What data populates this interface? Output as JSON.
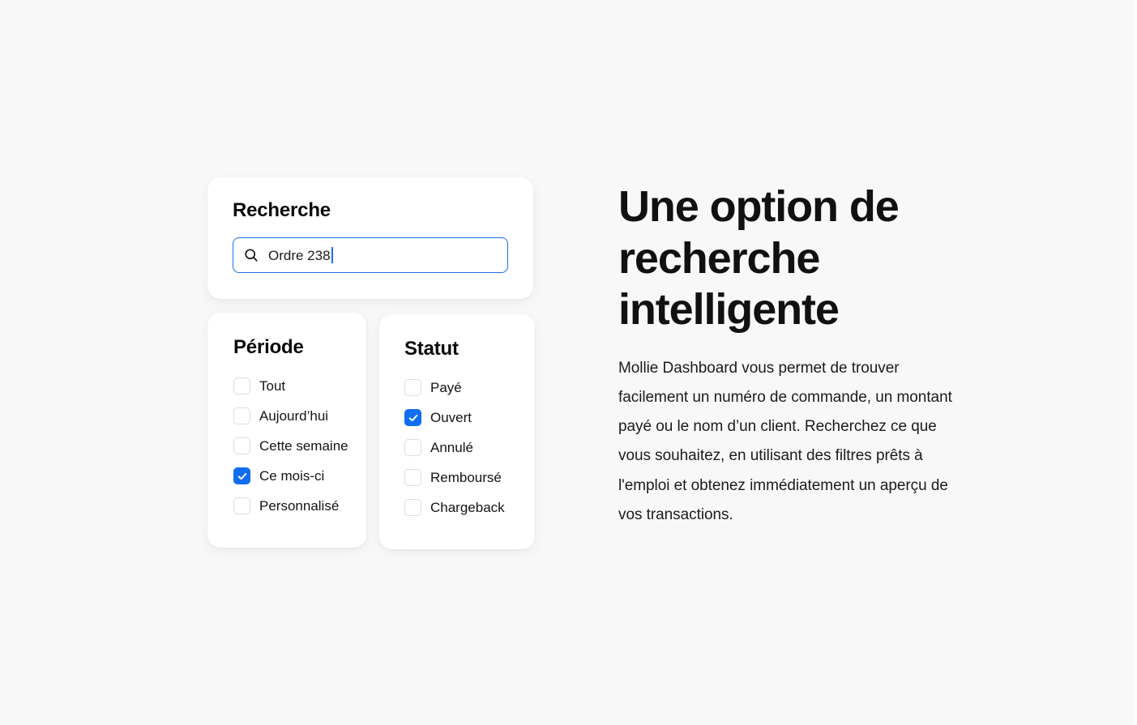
{
  "theme": {
    "background": "#f8f8f8",
    "card_background": "#ffffff",
    "accent_blue": "#0f6ef2",
    "focus_border": "#1a6ff0",
    "text_primary": "#111111",
    "checkbox_border": "#dedede"
  },
  "search_card": {
    "title": "Recherche",
    "icon": "search-icon",
    "value": "Ordre 238",
    "placeholder": "Recherche"
  },
  "period_card": {
    "title": "Période",
    "options": [
      {
        "label": "Tout",
        "checked": false
      },
      {
        "label": "Aujourd’hui",
        "checked": false
      },
      {
        "label": "Cette semaine",
        "checked": false
      },
      {
        "label": "Ce mois-ci",
        "checked": true
      },
      {
        "label": "Personnalisé",
        "checked": false
      }
    ]
  },
  "status_card": {
    "title": "Statut",
    "options": [
      {
        "label": "Payé",
        "checked": false
      },
      {
        "label": "Ouvert",
        "checked": true
      },
      {
        "label": "Annulé",
        "checked": false
      },
      {
        "label": "Remboursé",
        "checked": false
      },
      {
        "label": "Chargeback",
        "checked": false
      }
    ]
  },
  "copy": {
    "headline": "Une option de recherche intelligente",
    "body": "Mollie Dashboard vous permet de trouver facilement un numéro de commande, un montant payé ou le nom d’un client. Recherchez ce que vous souhaitez, en utilisant des filtres prêts à l'emploi et obtenez immédiatement un aperçu de vos transactions."
  }
}
